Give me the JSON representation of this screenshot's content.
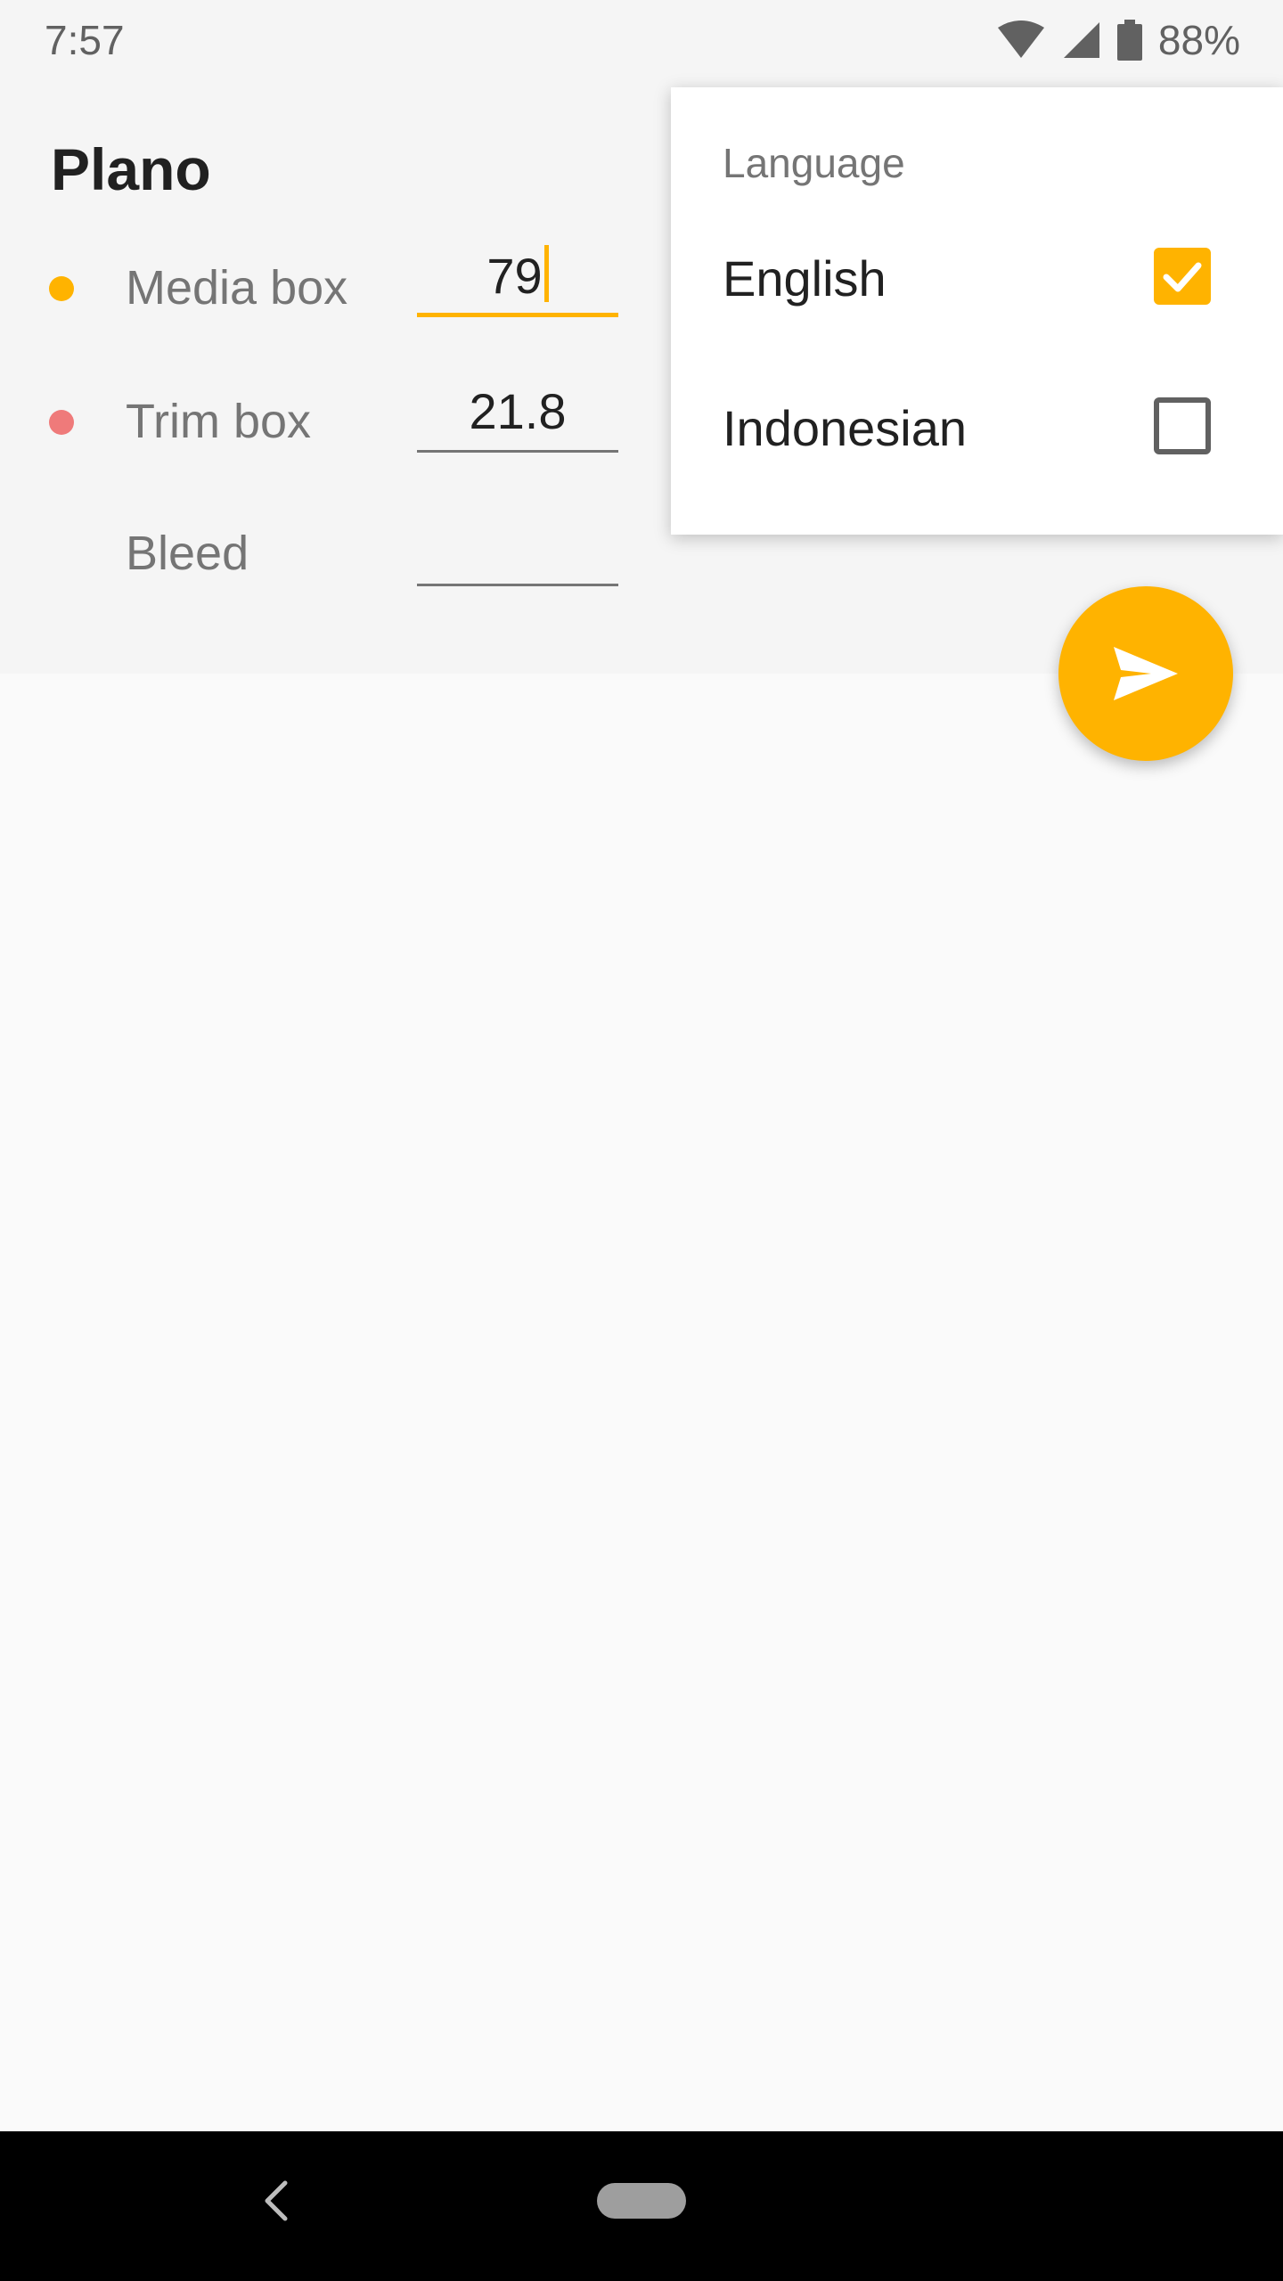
{
  "status_bar": {
    "time": "7:57",
    "battery_percent": "88%",
    "icons": [
      "wifi-icon",
      "signal-icon",
      "battery-icon"
    ]
  },
  "header": {
    "title": "Plano"
  },
  "form": {
    "rows": [
      {
        "label": "Media box",
        "value": "79",
        "dot_color": "#ffb300"
      },
      {
        "label": "Trim box",
        "value": "21.8",
        "dot_color": "#ef7a7a"
      },
      {
        "label": "Bleed",
        "value": ""
      }
    ]
  },
  "language_menu": {
    "header": "Language",
    "items": [
      {
        "label": "English",
        "checked": true
      },
      {
        "label": "Indonesian",
        "checked": false
      }
    ]
  },
  "fab": {
    "icon": "send-icon"
  },
  "nav_bar": {
    "icons": [
      "back-icon",
      "home-pill"
    ]
  },
  "colors": {
    "accent": "#ffb300",
    "header_bg": "#f5f5f5",
    "body_bg": "#fafafa"
  }
}
